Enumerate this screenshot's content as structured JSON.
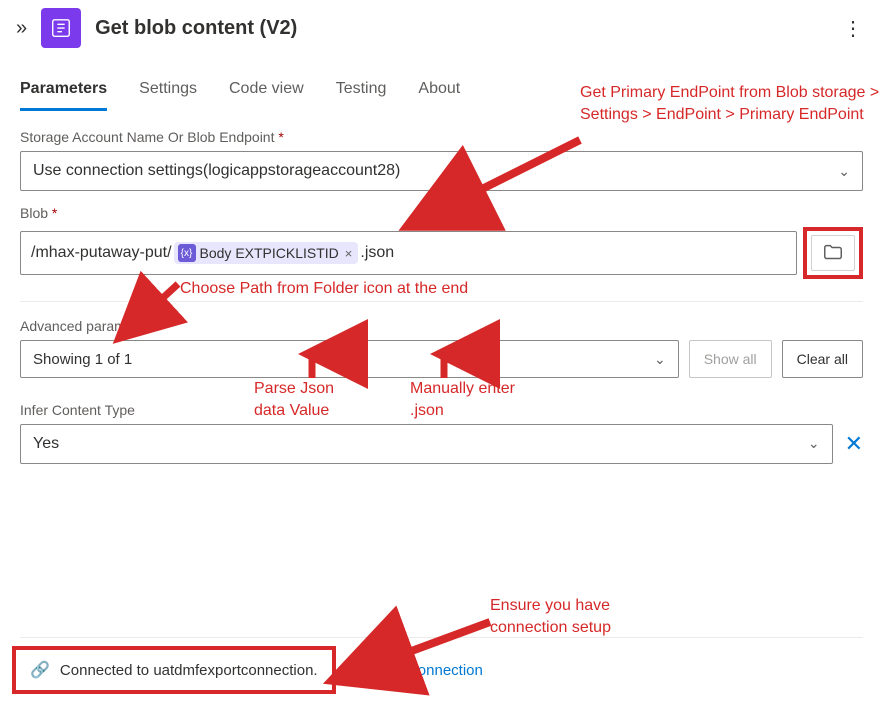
{
  "header": {
    "title": "Get blob content (V2)"
  },
  "tabs": [
    "Parameters",
    "Settings",
    "Code view",
    "Testing",
    "About"
  ],
  "fields": {
    "storage_label": "Storage Account Name Or Blob Endpoint",
    "storage_value": "Use connection settings(logicappstorageaccount28)",
    "blob_label": "Blob",
    "blob_prefix": "/mhax-putaway-put/",
    "blob_token": "Body EXTPICKLISTID",
    "blob_suffix": ".json",
    "adv_label": "Advanced parameters",
    "adv_value": "Showing 1 of 1",
    "show_all": "Show all",
    "clear_all": "Clear all",
    "infer_label": "Infer Content Type",
    "infer_value": "Yes"
  },
  "footer": {
    "connected": "Connected to uatdmfexportconnection.",
    "change": "Change connection"
  },
  "annotations": {
    "a1": "Get Primary EndPoint from Blob storage > Settings > EndPoint > Primary EndPoint",
    "a2": "Choose Path from Folder icon at the end",
    "a3": "Parse Json data Value",
    "a4": "Manually enter .json",
    "a5": "Ensure you have connection setup"
  }
}
